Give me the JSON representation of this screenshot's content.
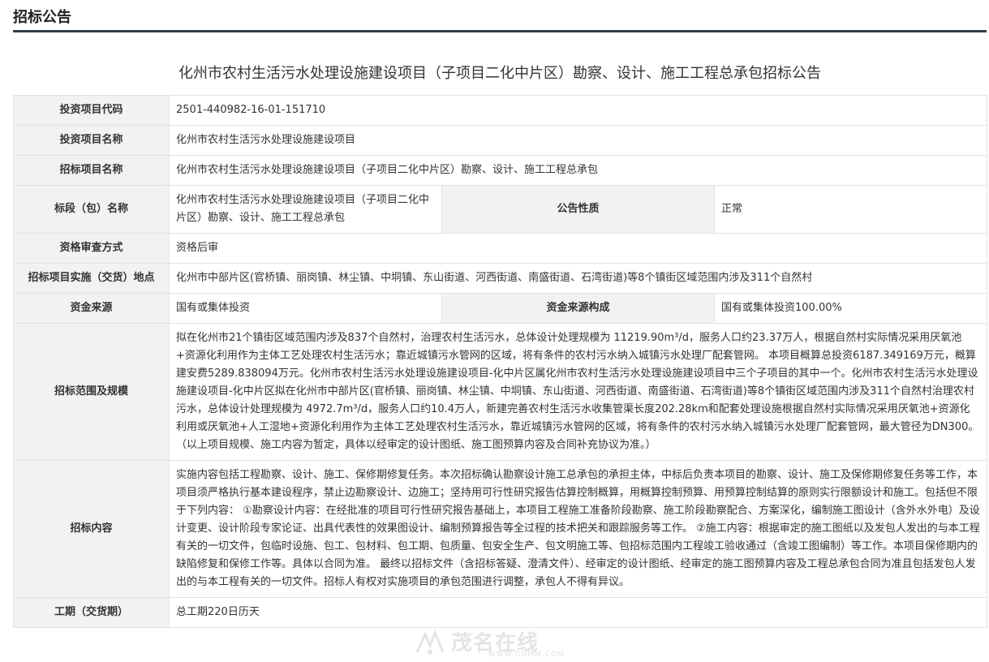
{
  "header": {
    "title": "招标公告"
  },
  "notice": {
    "title": "化州市农村生活污水处理设施建设项目（子项目二化中片区）勘察、设计、施工工程总承包招标公告"
  },
  "rows": {
    "project_code": {
      "label": "投资项目代码",
      "value": "2501-440982-16-01-151710"
    },
    "project_name": {
      "label": "投资项目名称",
      "value": "化州市农村生活污水处理设施建设项目"
    },
    "tender_project_name": {
      "label": "招标项目名称",
      "value": "化州市农村生活污水处理设施建设项目（子项目二化中片区）勘察、设计、施工工程总承包"
    },
    "section_name": {
      "label": "标段（包）名称",
      "value": "化州市农村生活污水处理设施建设项目（子项目二化中片区）勘察、设计、施工工程总承包",
      "nature_label": "公告性质",
      "nature_value": "正常"
    },
    "qualification": {
      "label": "资格审查方式",
      "value": "资格后审"
    },
    "location": {
      "label": "招标项目实施（交货）地点",
      "value": "化州市中部片区(官桥镇、丽岗镇、林尘镇、中垌镇、东山街道、河西街道、南盛街道、石湾街道)等8个镇街区域范围内涉及311个自然村"
    },
    "funding": {
      "label": "资金来源",
      "value": "国有或集体投资",
      "composition_label": "资金来源构成",
      "composition_value": "国有或集体投资100.00%"
    },
    "scope": {
      "label": "招标范围及规模",
      "value": "拟在化州市21个镇街区域范围内涉及837个自然村，治理农村生活污水，总体设计处理规模为 11219.90m³/d，服务人口约23.37万人，根据自然村实际情况采用厌氧池+资源化利用作为主体工艺处理农村生活污水；靠近城镇污水管网的区域，将有条件的农村污水纳入城镇污水处理厂配套管网。 本项目概算总投资6187.349169万元，概算建安费5289.838094万元。化州市农村生活污水处理设施建设项目-化中片区属化州市农村生活污水处理设施建设项目中三个子项目的其中一个。化州市农村生活污水处理设施建设项目-化中片区拟在化州市中部片区(官桥镇、丽岗镇、林尘镇、中垌镇、东山街道、河西街道、南盛街道、石湾街道)等8个镇街区域范围内涉及311个自然村治理农村污水，总体设计处理规模为 4972.7m³/d，服务人口约10.4万人，新建完善农村生活污水收集管渠长度202.28km和配套处理设施根据自然村实际情况采用厌氧池+资源化利用或厌氧池+人工湿地+资源化利用作为主体工艺处理农村生活污水，靠近城镇污水管网的区域，将有条件的农村污水纳入城镇污水处理厂配套管网，最大管径为DN300。（以上项目规模、施工内容为暂定，具体以经审定的设计图纸、施工图预算内容及合同补充协议为准。）"
    },
    "content": {
      "label": "招标内容",
      "value": "实施内容包括工程勘察、设计、施工、保修期修复任务。本次招标确认勘察设计施工总承包的承担主体，中标后负责本项目的勘察、设计、施工及保修期修复任务等工作，本项目须严格执行基本建设程序，禁止边勘察设计、边施工；坚持用可行性研究报告估算控制概算，用概算控制预算、用预算控制结算的原则实行限额设计和施工。包括但不限于下列内容： ①勘察设计内容：在经批准的项目可行性研究报告基础上，本项目工程施工准备阶段勘察、施工阶段勘察配合、方案深化，编制施工图设计（含外水外电）及设计变更、设计阶段专家论证、出具代表性的效果图设计、编制预算报告等全过程的技术把关和跟踪服务等工作。 ②施工内容：根据审定的施工图纸以及发包人发出的与本工程有关的一切文件，包临时设施、包工、包材料、包工期、包质量、包安全生产、包文明施工等、包招标范围内工程竣工验收通过（含竣工图编制）等工作。本项目保修期内的缺陷修复和保修工作等。具体以合同为准。 最终以招标文件（含招标答疑、澄清文件）、经审定的设计图纸、经审定的施工图预算内容及工程总承包合同为准且包括发包人发出的与本工程有关的一切文件。招标人有权对实施项目的承包范围进行调整，承包人不得有异议。"
    },
    "duration": {
      "label": "工期（交货期）",
      "value": "总工期220日历天"
    }
  },
  "watermark": {
    "logo": "茂名在线",
    "url": "WWW.GDMM.COM"
  },
  "colors": {
    "header_rule": "#333d47",
    "label_bg": "#f2f2f2",
    "border": "#e2e2e2",
    "text": "#333333"
  }
}
